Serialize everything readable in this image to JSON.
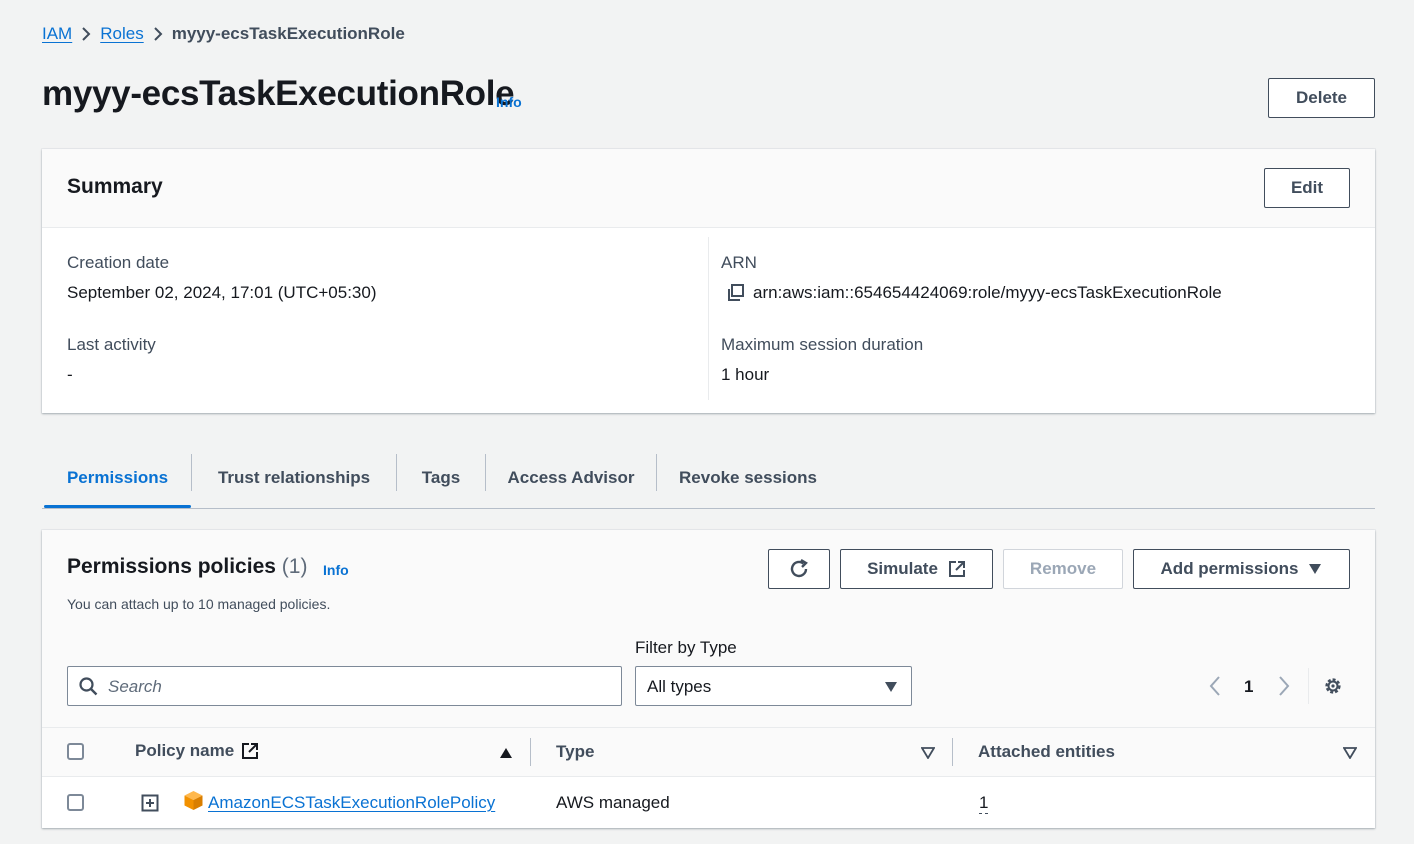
{
  "breadcrumb": {
    "items": [
      "IAM",
      "Roles"
    ],
    "current": "myyy-ecsTaskExecutionRole"
  },
  "page": {
    "title": "myyy-ecsTaskExecutionRole",
    "info_label": "Info",
    "delete_label": "Delete"
  },
  "summary": {
    "heading": "Summary",
    "edit_label": "Edit",
    "creation_date_label": "Creation date",
    "creation_date_value": "September 02, 2024, 17:01 (UTC+05:30)",
    "last_activity_label": "Last activity",
    "last_activity_value": "-",
    "arn_label": "ARN",
    "arn_value": "arn:aws:iam::654654424069:role/myyy-ecsTaskExecutionRole",
    "max_session_label": "Maximum session duration",
    "max_session_value": "1 hour"
  },
  "tabs": [
    "Permissions",
    "Trust relationships",
    "Tags",
    "Access Advisor",
    "Revoke sessions"
  ],
  "active_tab": "Permissions",
  "permissions": {
    "heading": "Permissions policies",
    "count": "(1)",
    "info_label": "Info",
    "description": "You can attach up to 10 managed policies.",
    "simulate_label": "Simulate",
    "remove_label": "Remove",
    "add_permissions_label": "Add permissions",
    "filter_label": "Filter by Type",
    "search_placeholder": "Search",
    "filter_value": "All types",
    "page_number": "1",
    "columns": {
      "policy_name": "Policy name",
      "type": "Type",
      "attached_entities": "Attached entities"
    },
    "rows": [
      {
        "policy_name": "AmazonECSTaskExecutionRolePolicy",
        "type": "AWS managed",
        "attached_entities": "1"
      }
    ]
  },
  "colors": {
    "link": "#0972d3",
    "background": "#f2f3f3",
    "text": "#16191f",
    "aws_managed_icon": "#f29100"
  },
  "icons": [
    "chevron-right-icon",
    "copy-icon",
    "refresh-icon",
    "external-link-icon",
    "caret-down-icon",
    "search-icon",
    "chevron-left-icon",
    "settings-icon",
    "sort-ascending-icon",
    "expand-icon",
    "aws-cube-icon"
  ]
}
